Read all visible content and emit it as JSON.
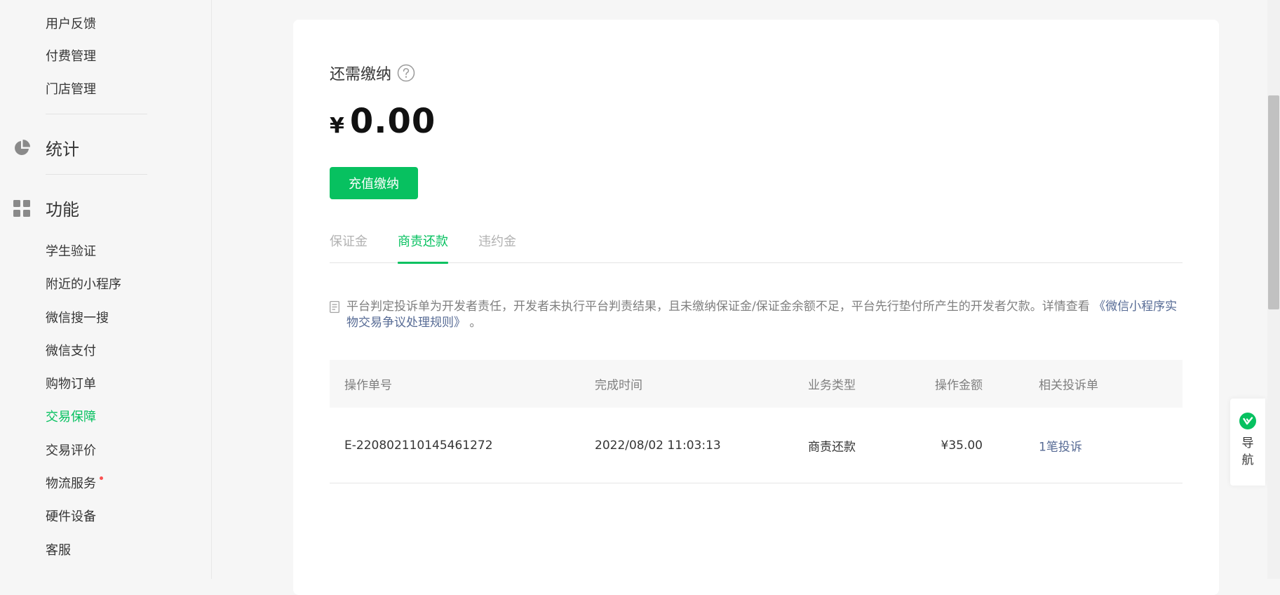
{
  "sidebar": {
    "top_items": [
      "用户反馈",
      "付费管理",
      "门店管理"
    ],
    "stats_section": "统计",
    "func_section": "功能",
    "func_items": [
      {
        "label": "学生验证"
      },
      {
        "label": "附近的小程序"
      },
      {
        "label": "微信搜一搜"
      },
      {
        "label": "微信支付"
      },
      {
        "label": "购物订单"
      },
      {
        "label": "交易保障",
        "active": true
      },
      {
        "label": "交易评价"
      },
      {
        "label": "物流服务",
        "dot": true
      },
      {
        "label": "硬件设备"
      },
      {
        "label": "客服"
      }
    ],
    "active_color": "#07c160"
  },
  "main": {
    "due_title": "还需缴纳",
    "currency_symbol": "¥",
    "amount": "0.00",
    "pay_button": "充值缴纳",
    "tabs": [
      {
        "label": "保证金"
      },
      {
        "label": "商责还款",
        "active": true
      },
      {
        "label": "违约金"
      }
    ],
    "notice_text": "平台判定投诉单为开发者责任，开发者未执行平台判责结果，且未缴纳保证金/保证金余额不足，平台先行垫付所产生的开发者欠款。详情查看",
    "notice_link": "《微信小程序实物交易争议处理规则》",
    "notice_end": "。",
    "table": {
      "headers": [
        "操作单号",
        "完成时间",
        "业务类型",
        "操作金额",
        "相关投诉单"
      ],
      "rows": [
        [
          "E-220802110145461272",
          "2022/08/02 11:03:13",
          "商责还款",
          "¥35.00",
          "1笔投诉"
        ]
      ]
    }
  },
  "float_nav": {
    "label": "导航"
  },
  "colors": {
    "brand_green": "#07c160",
    "link_blue": "#576b95"
  }
}
